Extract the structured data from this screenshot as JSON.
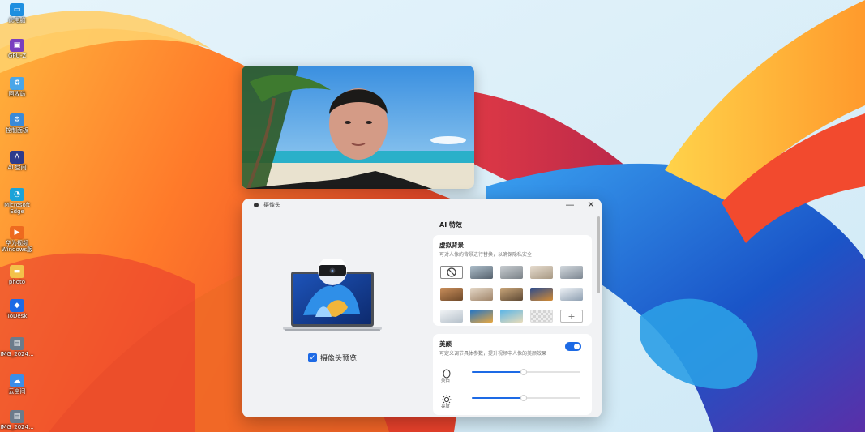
{
  "desktop": {
    "icons": [
      {
        "label": "此电脑",
        "icon": "computer-icon",
        "color": "#1e8fe0"
      },
      {
        "label": "GPU-Z",
        "icon": "gpu-z-icon",
        "color": "#7a3fbf"
      },
      {
        "label": "回收站",
        "icon": "recycle-bin-icon",
        "color": "#4aa6e8"
      },
      {
        "label": "控制面板",
        "icon": "control-panel-icon",
        "color": "#3a8ad8"
      },
      {
        "label": "AI 空间",
        "icon": "ai-space-icon",
        "color": "#2d3b8c"
      },
      {
        "label": "Microsoft Edge",
        "icon": "edge-icon",
        "color": "#1aa3d8"
      },
      {
        "label": "华为视频 Windows版",
        "icon": "huawei-video-icon",
        "color": "#ee6a1f"
      },
      {
        "label": "photo",
        "icon": "folder-icon",
        "color": "#f3c24a"
      },
      {
        "label": "ToDesk",
        "icon": "todesk-icon",
        "color": "#1d6ae5"
      },
      {
        "label": "IMG_2024...",
        "icon": "image-file-icon",
        "color": "#6b7b8b"
      },
      {
        "label": "云空间",
        "icon": "cloud-icon",
        "color": "#3c8de8"
      },
      {
        "label": "IMG_2024...",
        "icon": "image-file-icon",
        "color": "#6b7b8b"
      }
    ]
  },
  "dialog": {
    "title": "摄像头",
    "minimize_label": "—",
    "close_label": "✕",
    "preview_checkbox_label": "摄像头预览",
    "preview_checked": true,
    "ai_title": "AI 特效",
    "virtual_background": {
      "title": "虚拟背景",
      "description": "可对人像的背景进行替换，以确保隐私安全",
      "thumbnails": [
        {
          "name": "none",
          "kind": "none"
        },
        {
          "name": "office",
          "kind": "image",
          "colors": [
            "#aebfcb",
            "#56626e"
          ]
        },
        {
          "name": "meeting-room",
          "kind": "image",
          "colors": [
            "#c9ced2",
            "#7b8288"
          ]
        },
        {
          "name": "living-room",
          "kind": "image",
          "colors": [
            "#e7ddd0",
            "#a89984"
          ]
        },
        {
          "name": "hall",
          "kind": "image",
          "colors": [
            "#d4dadf",
            "#7d8792"
          ]
        },
        {
          "name": "study",
          "kind": "image",
          "colors": [
            "#c98e5b",
            "#6f4a2a"
          ]
        },
        {
          "name": "lounge",
          "kind": "image",
          "colors": [
            "#e5d8c7",
            "#a0856a"
          ]
        },
        {
          "name": "bookshelf",
          "kind": "image",
          "colors": [
            "#c9a67a",
            "#5f4a35"
          ]
        },
        {
          "name": "night-city",
          "kind": "image",
          "colors": [
            "#2d4c8d",
            "#d38b33"
          ]
        },
        {
          "name": "light-space",
          "kind": "image",
          "colors": [
            "#eef2f6",
            "#8fa0b2"
          ]
        },
        {
          "name": "white-room",
          "kind": "image",
          "colors": [
            "#f2f4f6",
            "#b6c1cb"
          ]
        },
        {
          "name": "blue-wave",
          "kind": "image",
          "colors": [
            "#1e74c9",
            "#e8a73f"
          ]
        },
        {
          "name": "beach",
          "kind": "image",
          "colors": [
            "#58b4e8",
            "#e9dcb9"
          ]
        },
        {
          "name": "transparent",
          "kind": "transparent"
        },
        {
          "name": "add",
          "kind": "add",
          "label": "+"
        }
      ]
    },
    "beauty": {
      "title": "美颜",
      "description": "可定义调节具体参数，提升视频中人像的美颜效果",
      "enabled": true,
      "sliders": [
        {
          "label": "美白",
          "icon": "face-icon",
          "value": 0.48
        },
        {
          "label": "亮度",
          "icon": "brightness-icon",
          "value": 0.48
        }
      ]
    }
  },
  "colors": {
    "accent": "#1d6ae5",
    "dialog_bg": "#f1f2f4"
  }
}
